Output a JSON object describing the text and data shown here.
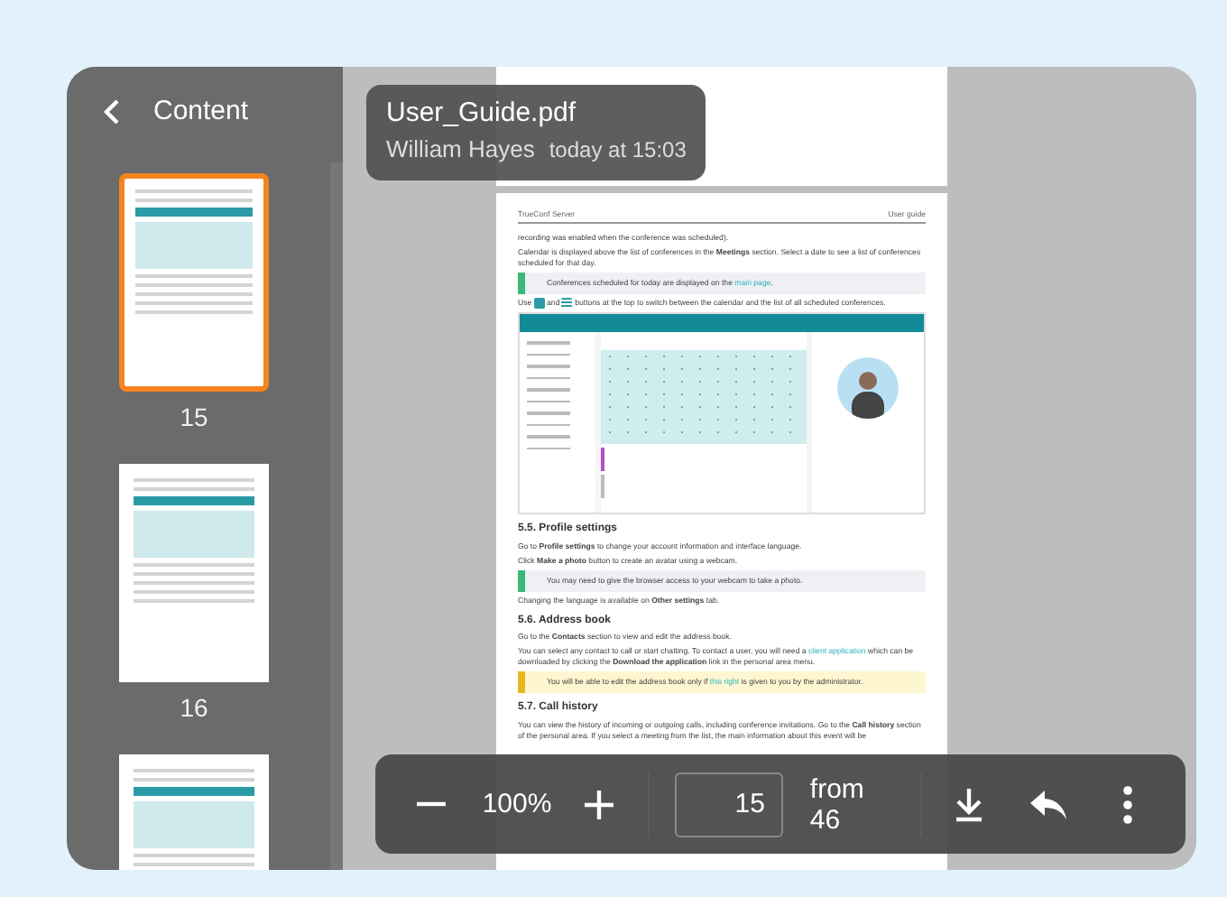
{
  "sidebar": {
    "title": "Content",
    "thumbnails": [
      {
        "label": "15",
        "selected": true
      },
      {
        "label": "16",
        "selected": false
      },
      {
        "selected": false
      }
    ]
  },
  "file_info": {
    "name": "User_Guide.pdf",
    "author": "William Hayes",
    "time": "today at 15:03"
  },
  "document": {
    "header_left": "TrueConf Server",
    "header_right": "User guide",
    "blocks": [
      {
        "kind": "para",
        "parts": [
          {
            "kind": "text",
            "text": "recording was enabled when the conference was scheduled)."
          }
        ]
      },
      {
        "kind": "para",
        "parts": [
          {
            "kind": "text",
            "text": "Calendar is displayed above the list of conferences in the **Meetings** section. Select a date to see a list of conferences scheduled for that day."
          }
        ]
      },
      {
        "kind": "info_note",
        "parts": [
          {
            "kind": "text",
            "text": "Conferences scheduled for today are displayed on the "
          },
          {
            "kind": "link",
            "text": "main page"
          },
          {
            "kind": "text",
            "text": "."
          }
        ]
      },
      {
        "kind": "para",
        "parts": [
          {
            "kind": "text",
            "text": "Use "
          },
          {
            "kind": "calendar-icon"
          },
          {
            "kind": "text",
            "text": " and "
          },
          {
            "kind": "list-icon"
          },
          {
            "kind": "text",
            "text": " buttons at the top to switch between the calendar and the list of all scheduled conferences."
          }
        ]
      },
      {
        "kind": "screenshot"
      },
      {
        "kind": "heading",
        "text": "5.5. Profile settings"
      },
      {
        "kind": "para",
        "parts": [
          {
            "kind": "text",
            "text": "Go to **Profile settings** to change your account information and interface language."
          }
        ]
      },
      {
        "kind": "para",
        "parts": [
          {
            "kind": "text",
            "text": "Click **Make a photo** button to create an avatar using a webcam."
          }
        ]
      },
      {
        "kind": "info_note",
        "parts": [
          {
            "kind": "text",
            "text": "You may need to give the browser access to your webcam to take a photo."
          }
        ]
      },
      {
        "kind": "para",
        "parts": [
          {
            "kind": "text",
            "text": "Changing the language is available on **Other settings** tab."
          }
        ]
      },
      {
        "kind": "heading",
        "text": "5.6. Address book"
      },
      {
        "kind": "para",
        "parts": [
          {
            "kind": "text",
            "text": "Go to the **Contacts** section to view and edit the address book."
          }
        ]
      },
      {
        "kind": "para",
        "parts": [
          {
            "kind": "text",
            "text": "You can select any contact to call or start chatting. To contact a user, you will need a "
          },
          {
            "kind": "link",
            "text": "client application"
          },
          {
            "kind": "text",
            "text": " which can be downloaded by clicking the **Download the application** link in the personal area menu."
          }
        ]
      },
      {
        "kind": "warning_note",
        "parts": [
          {
            "kind": "text",
            "text": "You will be able to edit the address book only if "
          },
          {
            "kind": "link",
            "text": "this right"
          },
          {
            "kind": "text",
            "text": " is given to you by the administrator."
          }
        ]
      },
      {
        "kind": "heading",
        "text": "5.7. Call history"
      },
      {
        "kind": "para",
        "parts": [
          {
            "kind": "text",
            "text": "You can view the history of incoming or outgoing calls, including conference invitations. Go to the **Call history** section of the personal area. If you select a meeting from the list, the main information about this event will be"
          }
        ]
      }
    ]
  },
  "toolbar": {
    "zoom": "100%",
    "page": "15",
    "page_count": "from 46"
  }
}
